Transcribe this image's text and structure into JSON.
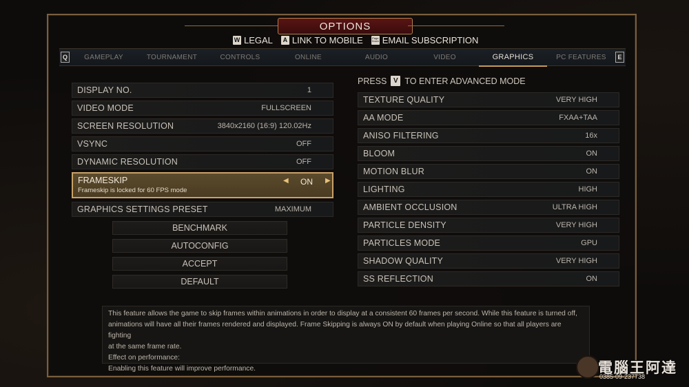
{
  "header": {
    "title": "OPTIONS",
    "subnav": [
      {
        "key": "W",
        "label": "LEGAL"
      },
      {
        "key": "A",
        "label": "LINK TO MOBILE"
      },
      {
        "key": "Page Down",
        "label": "EMAIL SUBSCRIPTION"
      }
    ]
  },
  "tabs": {
    "left_key": "Q",
    "right_key": "E",
    "items": [
      "GAMEPLAY",
      "TOURNAMENT",
      "CONTROLS",
      "ONLINE",
      "AUDIO",
      "VIDEO",
      "GRAPHICS",
      "PC FEATURES"
    ],
    "active": "GRAPHICS"
  },
  "left_settings": [
    {
      "label": "DISPLAY NO.",
      "value": "1"
    },
    {
      "label": "VIDEO MODE",
      "value": "FULLSCREEN"
    },
    {
      "label": "SCREEN RESOLUTION",
      "value": "3840x2160 (16:9) 120.02Hz"
    },
    {
      "label": "VSYNC",
      "value": "OFF"
    },
    {
      "label": "DYNAMIC RESOLUTION",
      "value": "OFF"
    }
  ],
  "frameskip": {
    "label": "FRAMESKIP",
    "sublabel": "Frameskip is locked for 60 FPS mode",
    "value": "ON"
  },
  "preset": {
    "label": "GRAPHICS SETTINGS PRESET",
    "value": "MAXIMUM"
  },
  "buttons": [
    "BENCHMARK",
    "AUTOCONFIG",
    "ACCEPT",
    "DEFAULT"
  ],
  "advanced": {
    "press": "PRESS",
    "key": "V",
    "text": "TO ENTER ADVANCED MODE"
  },
  "right_settings": [
    {
      "label": "TEXTURE QUALITY",
      "value": "VERY HIGH"
    },
    {
      "label": "AA MODE",
      "value": "FXAA+TAA"
    },
    {
      "label": "ANISO FILTERING",
      "value": "16x"
    },
    {
      "label": "BLOOM",
      "value": "ON"
    },
    {
      "label": "MOTION BLUR",
      "value": "ON"
    },
    {
      "label": "LIGHTING",
      "value": "HIGH"
    },
    {
      "label": "AMBIENT OCCLUSION",
      "value": "ULTRA HIGH"
    },
    {
      "label": "PARTICLE DENSITY",
      "value": "VERY HIGH"
    },
    {
      "label": "PARTICLES MODE",
      "value": "GPU"
    },
    {
      "label": "SHADOW QUALITY",
      "value": "VERY HIGH"
    },
    {
      "label": "SS REFLECTION",
      "value": "ON"
    }
  ],
  "description": {
    "line1": "This feature allows the game to skip frames within animations in order to display at a consistent 60 frames per second. While this feature is turned off,",
    "line2": "animations will have all their frames rendered and displayed. Frame Skipping is always ON by default when playing Online so that all players are fighting",
    "line3": "at the same frame rate.",
    "line4": "Effect on performance:",
    "line5": "Enabling this feature will improve performance."
  },
  "watermark": {
    "text": "電腦王阿達",
    "url": "0385-09-237738"
  },
  "colors": {
    "accent": "#c89a5a",
    "title_bg": "#5a1414",
    "frame": "#7a5f3e"
  }
}
